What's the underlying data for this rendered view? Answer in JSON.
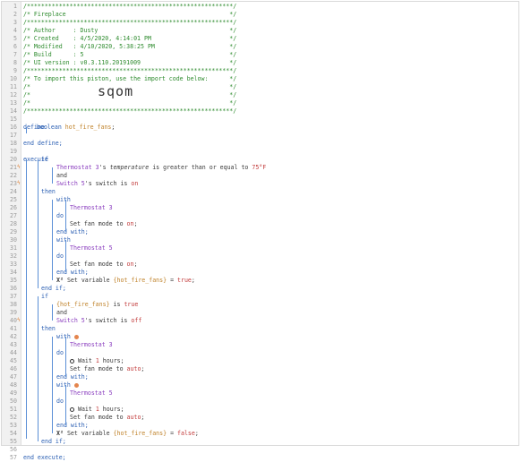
{
  "lines": [
    {
      "n": "1",
      "t": "/**********************************************************/",
      "cls": "c-comment"
    },
    {
      "n": "2",
      "t": "/* Fireplace                                              */",
      "cls": "c-comment"
    },
    {
      "n": "3",
      "t": "/**********************************************************/",
      "cls": "c-comment"
    },
    {
      "n": "4",
      "t": "/* Author     : Dusty                                     */",
      "cls": "c-comment"
    },
    {
      "n": "5",
      "t": "/* Created    : 4/5/2020, 4:14:01 PM                      */",
      "cls": "c-comment"
    },
    {
      "n": "6",
      "t": "/* Modified   : 4/10/2020, 5:38:25 PM                     */",
      "cls": "c-comment"
    },
    {
      "n": "7",
      "t": "/* Build      : 5                                         */",
      "cls": "c-comment"
    },
    {
      "n": "8",
      "t": "/* UI version : v0.3.110.20191009                         */",
      "cls": "c-comment"
    },
    {
      "n": "9",
      "t": "/**********************************************************/",
      "cls": "c-comment"
    },
    {
      "n": "10",
      "t": "/* To import this piston, use the import code below:      */",
      "cls": "c-comment"
    },
    {
      "n": "11",
      "t": "/*                                                        */",
      "cls": "c-comment"
    },
    {
      "n": "12",
      "t": "/*                                                        */",
      "cls": "c-comment"
    },
    {
      "n": "13",
      "t": "/*                                                        */",
      "cls": "c-comment"
    },
    {
      "n": "14",
      "t": "/**********************************************************/",
      "cls": "c-comment"
    },
    {
      "n": "15",
      "t": "",
      "cls": ""
    },
    {
      "n": "16",
      "t": "define",
      "cls": "c-kw"
    },
    {
      "n": "17",
      "t": "",
      "cls": ""
    },
    {
      "n": "18",
      "t": "end define;",
      "cls": "c-kw"
    },
    {
      "n": "19",
      "t": "",
      "cls": ""
    },
    {
      "n": "20",
      "t": "execute",
      "cls": "c-kw"
    },
    {
      "n": "21",
      "t": "",
      "cls": ""
    },
    {
      "n": "22",
      "t": "",
      "cls": ""
    },
    {
      "n": "23",
      "t": "",
      "cls": ""
    },
    {
      "n": "24",
      "t": "",
      "cls": ""
    },
    {
      "n": "25",
      "t": "",
      "cls": ""
    },
    {
      "n": "26",
      "t": "",
      "cls": ""
    },
    {
      "n": "27",
      "t": "",
      "cls": ""
    },
    {
      "n": "28",
      "t": "",
      "cls": ""
    },
    {
      "n": "29",
      "t": "",
      "cls": ""
    },
    {
      "n": "30",
      "t": "",
      "cls": ""
    },
    {
      "n": "31",
      "t": "",
      "cls": ""
    },
    {
      "n": "32",
      "t": "",
      "cls": ""
    },
    {
      "n": "33",
      "t": "",
      "cls": ""
    },
    {
      "n": "34",
      "t": "",
      "cls": ""
    },
    {
      "n": "35",
      "t": "",
      "cls": ""
    },
    {
      "n": "36",
      "t": "",
      "cls": ""
    },
    {
      "n": "37",
      "t": "",
      "cls": ""
    },
    {
      "n": "38",
      "t": "",
      "cls": ""
    },
    {
      "n": "39",
      "t": "",
      "cls": ""
    },
    {
      "n": "40",
      "t": "",
      "cls": ""
    },
    {
      "n": "41",
      "t": "",
      "cls": ""
    },
    {
      "n": "42",
      "t": "",
      "cls": ""
    },
    {
      "n": "43",
      "t": "",
      "cls": ""
    },
    {
      "n": "44",
      "t": "",
      "cls": ""
    },
    {
      "n": "45",
      "t": "",
      "cls": ""
    },
    {
      "n": "46",
      "t": "",
      "cls": ""
    },
    {
      "n": "47",
      "t": "",
      "cls": ""
    },
    {
      "n": "48",
      "t": "",
      "cls": ""
    },
    {
      "n": "49",
      "t": "",
      "cls": ""
    },
    {
      "n": "50",
      "t": "",
      "cls": ""
    },
    {
      "n": "51",
      "t": "",
      "cls": ""
    },
    {
      "n": "52",
      "t": "",
      "cls": ""
    },
    {
      "n": "53",
      "t": "",
      "cls": ""
    },
    {
      "n": "54",
      "t": "",
      "cls": ""
    },
    {
      "n": "55",
      "t": "",
      "cls": ""
    },
    {
      "n": "56",
      "t": "",
      "cls": ""
    },
    {
      "n": "57",
      "t": "end execute;",
      "cls": "c-kw"
    }
  ],
  "import_code": "sqom",
  "code": {
    "boolean_kw": "boolean",
    "var_name": "hot_fire_fans",
    "semi": ";",
    "if": "if",
    "then": "then",
    "and": "and",
    "with": "with",
    "do": "do",
    "end_with": "end with;",
    "end_if": "end if;",
    "thermostat3": "Thermostat 3",
    "thermostat5": "Thermostat 5",
    "switch5": "Switch 5",
    "cond1_a": "'s ",
    "cond1_attr": "temperature",
    "cond1_b": " is greater than or equal to ",
    "cond1_val": "75°F",
    "cond2_a": "'s switch is ",
    "cond2_val": "on",
    "cond3_var": "{hot_fire_fans}",
    "cond3_b": " is ",
    "cond3_val": "true",
    "cond4_val": "off",
    "set_fan_mode": "Set fan mode to ",
    "fan_on": "on",
    "fan_auto": "auto",
    "wait_a": "Wait ",
    "wait_val": "1",
    "wait_b": " hours;",
    "set_var": "Set variable ",
    "assign_eq": " = ",
    "val_true": "true",
    "val_false": "false",
    "x2": "X²"
  }
}
